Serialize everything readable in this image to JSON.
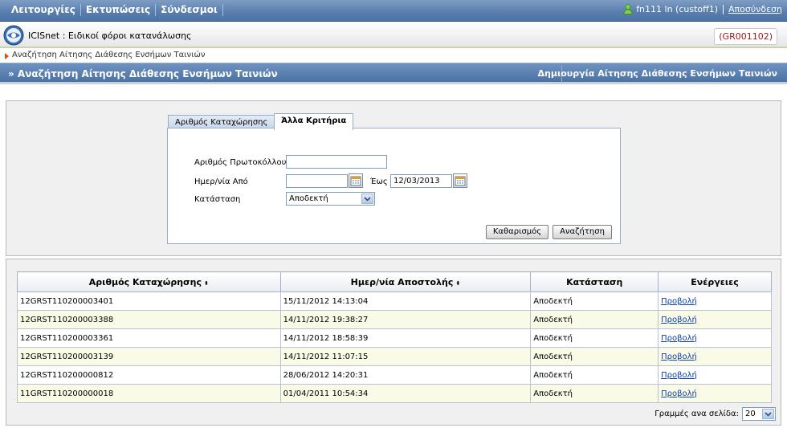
{
  "menu": {
    "items": [
      "Λειτουργίες",
      "Εκτυπώσεις",
      "Σύνδεσμοι"
    ]
  },
  "user": {
    "name": "fn111 ln (custoff1)",
    "logout": "Αποσύνδεση"
  },
  "app": {
    "title": "ICISnet : Ειδικοί φόροι κατανάλωσης",
    "code": "(GR001102)"
  },
  "breadcrumb": "Αναζήτηση Αίτησης Διάθεσης Ενσήμων Ταινιών",
  "band": {
    "title": "» Αναζήτηση Αίτησης Διάθεσης Ενσήμων Ταινιών",
    "create_link": "Δημιουργία Αίτησης Διάθεσης Ενσήμων Ταινιών"
  },
  "tabs": [
    "Αριθμός Καταχώρησης",
    "Άλλα Κριτήρια"
  ],
  "form": {
    "protocol_label": "Αριθμός Πρωτοκόλλου",
    "protocol_value": "",
    "date_from_label": "Ημερ/νία Από",
    "date_from_value": "",
    "date_to_label": "Έως",
    "date_to_value": "12/03/2013",
    "status_label": "Κατάσταση",
    "status_value": "Αποδεκτή",
    "clear_button": "Καθαρισμός",
    "search_button": "Αναζήτηση"
  },
  "table": {
    "headers": [
      "Αριθμός Καταχώρησης",
      "Ημερ/νία Αποστολής",
      "Κατάσταση",
      "Ενέργειες"
    ],
    "sort_glyph": "⬍",
    "rows": [
      [
        "12GRST110200003401",
        "15/11/2012 14:13:04",
        "Αποδεκτή",
        "Προβολή"
      ],
      [
        "12GRST110200003388",
        "14/11/2012 19:38:27",
        "Αποδεκτή",
        "Προβολή"
      ],
      [
        "12GRST110200003361",
        "14/11/2012 18:58:39",
        "Αποδεκτή",
        "Προβολή"
      ],
      [
        "12GRST110200003139",
        "14/11/2012 11:07:15",
        "Αποδεκτή",
        "Προβολή"
      ],
      [
        "12GRST110200000812",
        "28/06/2012 14:20:31",
        "Αποδεκτή",
        "Προβολή"
      ],
      [
        "11GRST110200000018",
        "01/04/2011 10:54:34",
        "Αποδεκτή",
        "Προβολή"
      ]
    ]
  },
  "pager": {
    "label": "Γραμμές ανα σελίδα:",
    "value": "20"
  },
  "icons": {
    "user": "user-icon",
    "logo": "globe-logo-icon",
    "calendar": "calendar-icon",
    "dropdown": "chevron-down-icon"
  }
}
